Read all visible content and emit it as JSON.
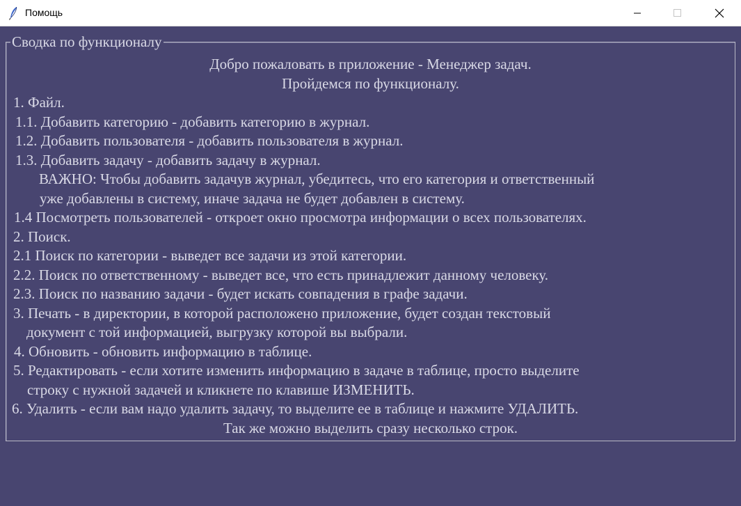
{
  "window": {
    "title": "Помощь",
    "icon": "feather-icon",
    "controls": [
      "minimize-icon",
      "maximize-icon",
      "close-icon"
    ]
  },
  "frame": {
    "label": "Сводка по функционалу"
  },
  "colors": {
    "background": "#484570",
    "text": "#d9d9e6",
    "titlebar": "#ffffff"
  },
  "help_lines": [
    "Добро пожаловать в приложение - Менеджер задач.",
    "Пройдемся по функционалу.",
    "1. Файл.",
    "1.1. Добавить категорию - добавить категорию в журнал.",
    "1.2. Добавить пользователя - добавить пользователя в журнал.",
    "1.3. Добавить задачу - добавить задачу в журнал.",
    "ВАЖНО: Чтобы добавить задачув журнал, убедитесь, что его категория и ответственный",
    "уже добавлены в систему, иначе задача не будет добавлен в систему.",
    "1.4 Посмотреть пользователей - откроет окно просмотра информации о всех пользователях.",
    "2. Поиск.",
    "2.1 Поиск по категории - выведет все задачи из этой категории.",
    "2.2. Поиск по ответственному - выведет все, что есть принадлежит данному человеку.",
    "2.3. Поиск по названию задачи - будет искать совпадения в графе задачи.",
    "3. Печать - в директории, в которой расположено приложение, будет создан текстовый",
    "документ с той информацией, выгрузку которой вы выбрали.",
    "4. Обновить - обновить информацию в таблице.",
    "5. Редактировать - если хотите изменить информацию в задаче в таблице, просто выделите",
    "строку с нужной задачей и кликнете по клавише ИЗМЕНИТЬ.",
    "6. Удалить - если вам надо удалить задачу, то выделите ее в таблице и нажмите УДАЛИТЬ.",
    "Так же можно выделить сразу несколько строк."
  ]
}
